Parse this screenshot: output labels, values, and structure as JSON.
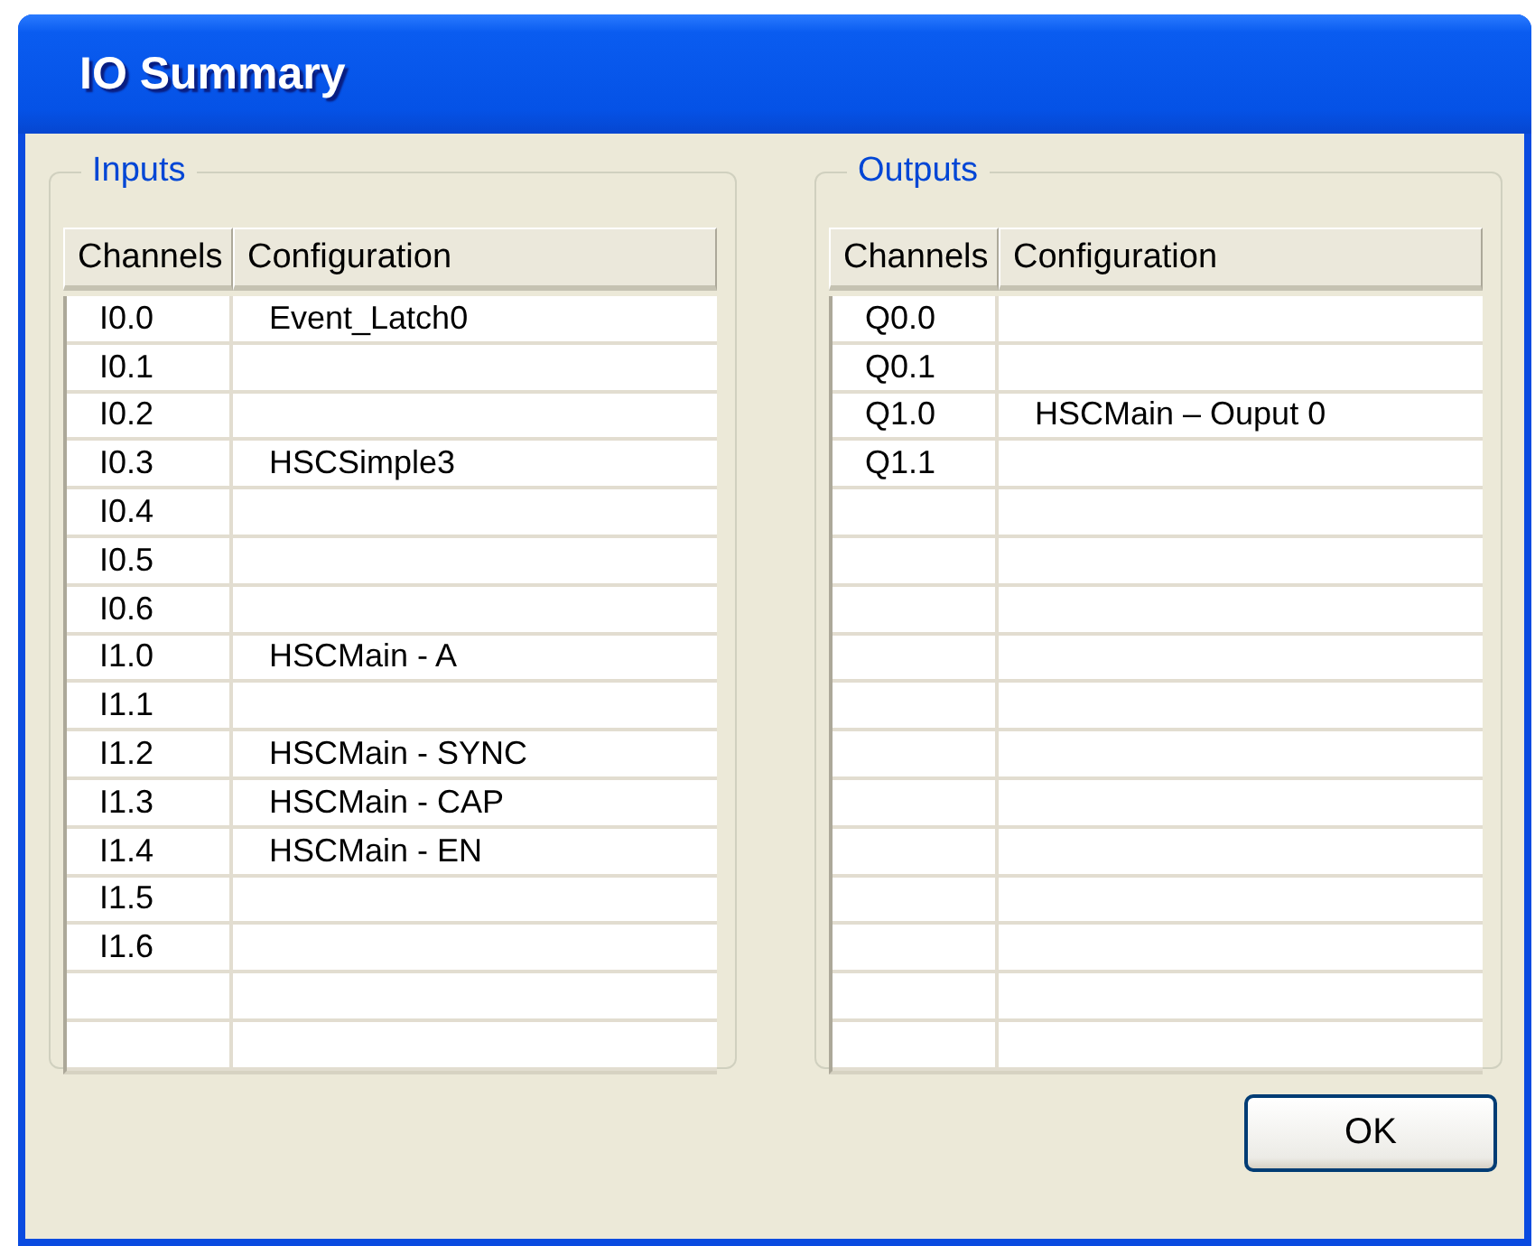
{
  "window": {
    "title": "IO Summary"
  },
  "groups": [
    {
      "label": "Inputs",
      "columns": [
        "Channels",
        "Configuration"
      ],
      "rows": [
        {
          "channel": "I0.0",
          "configuration": "Event_Latch0"
        },
        {
          "channel": "I0.1"
        },
        {
          "channel": "I0.2"
        },
        {
          "channel": "I0.3",
          "configuration": "HSCSimple3"
        },
        {
          "channel": "I0.4"
        },
        {
          "channel": "I0.5"
        },
        {
          "channel": "I0.6"
        },
        {
          "channel": "I1.0",
          "configuration": "HSCMain - A"
        },
        {
          "channel": "I1.1"
        },
        {
          "channel": "I1.2",
          "configuration": "HSCMain - SYNC"
        },
        {
          "channel": "I1.3",
          "configuration": "HSCMain - CAP"
        },
        {
          "channel": "I1.4",
          "configuration": "HSCMain - EN"
        },
        {
          "channel": "I1.5"
        },
        {
          "channel": "I1.6"
        }
      ]
    },
    {
      "label": "Outputs",
      "columns": [
        "Channels",
        "Configuration"
      ],
      "rows": [
        {
          "channel": "Q0.0"
        },
        {
          "channel": "Q0.1"
        },
        {
          "channel": "Q1.0",
          "configuration": "HSCMain – Ouput 0"
        },
        {
          "channel": "Q1.1"
        }
      ]
    }
  ],
  "buttons": [
    "OK"
  ]
}
